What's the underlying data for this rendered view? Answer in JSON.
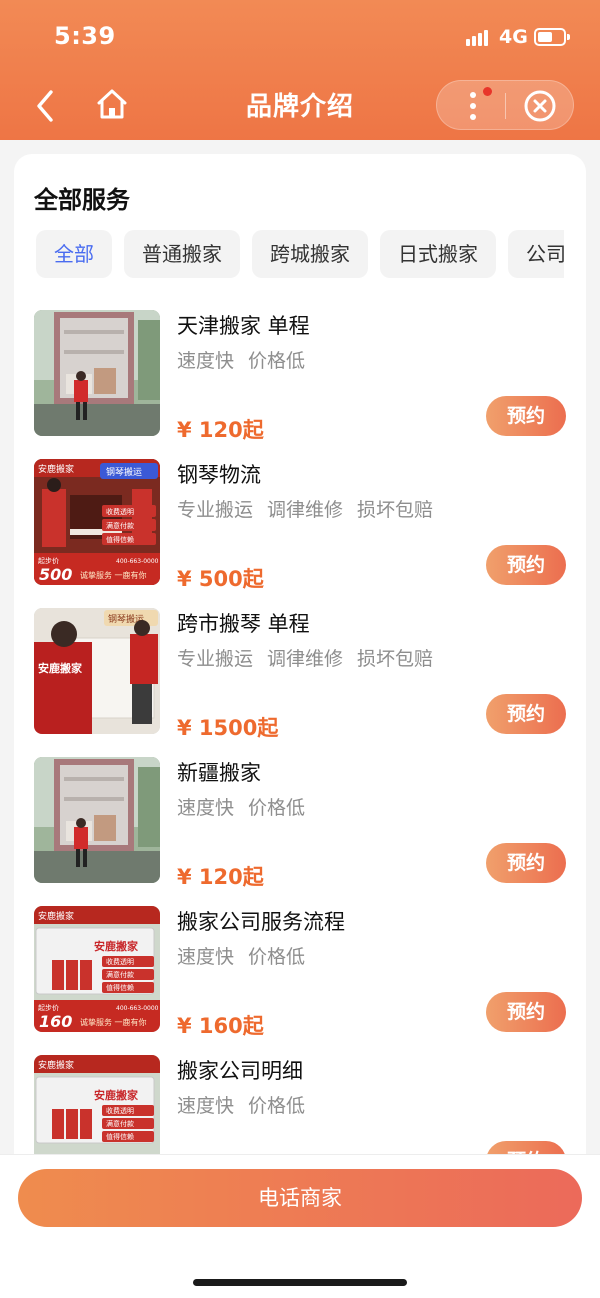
{
  "status_bar": {
    "time": "5:39",
    "network": "4G"
  },
  "nav": {
    "title": "品牌介绍"
  },
  "section": {
    "title": "全部服务"
  },
  "tabs": [
    {
      "label": "全部",
      "active": true
    },
    {
      "label": "普通搬家",
      "active": false
    },
    {
      "label": "跨城搬家",
      "active": false
    },
    {
      "label": "日式搬家",
      "active": false
    },
    {
      "label": "公司",
      "active": false
    }
  ],
  "items": [
    {
      "title": "天津搬家 单程",
      "tags": [
        "速度快",
        "价格低"
      ],
      "price": "¥ 120起",
      "button": "预约",
      "thumb": "truck-loading"
    },
    {
      "title": "钢琴物流",
      "tags": [
        "专业搬运",
        "调律维修",
        "损坏包赔"
      ],
      "price": "¥ 500起",
      "button": "预约",
      "thumb": "piano-promo",
      "thumb_text": {
        "brand": "安鹿搬家",
        "badge": "钢琴搬运",
        "bullets": [
          "收费透明",
          "满意付款",
          "值得信赖"
        ],
        "from_label": "起步价",
        "from_price": "500",
        "phone": "400-663-0000",
        "slogan": "诚挚服务 一鹿有你"
      }
    },
    {
      "title": "跨市搬琴 单程",
      "tags": [
        "专业搬运",
        "调律维修",
        "损坏包赔"
      ],
      "price": "¥ 1500起",
      "button": "预约",
      "thumb": "piano-movers",
      "thumb_text": {
        "badge": "钢琴搬运",
        "shirt": "安鹿搬家"
      }
    },
    {
      "title": "新疆搬家",
      "tags": [
        "速度快",
        "价格低"
      ],
      "price": "¥ 120起",
      "button": "预约",
      "thumb": "truck-loading"
    },
    {
      "title": "搬家公司服务流程",
      "tags": [
        "速度快",
        "价格低"
      ],
      "price": "¥ 160起",
      "button": "预约",
      "thumb": "truck-promo",
      "thumb_text": {
        "brand": "安鹿搬家",
        "truck": "安鹿搬家",
        "bullets": [
          "收费透明",
          "满意付款",
          "值得信赖"
        ],
        "from_label": "起步价",
        "from_price": "160",
        "phone": "400-663-0000",
        "slogan": "诚挚服务 一鹿有你"
      }
    },
    {
      "title": "搬家公司明细",
      "tags": [
        "速度快",
        "价格低"
      ],
      "price": "",
      "button": "预约",
      "thumb": "truck-promo",
      "thumb_text": {
        "brand": "安鹿搬家",
        "truck": "安鹿搬家",
        "bullets": [
          "收费透明",
          "满意付款",
          "值得信赖"
        ]
      }
    }
  ],
  "bottom": {
    "call_label": "电话商家"
  },
  "colors": {
    "accent": "#ee7545",
    "price": "#ee6a2e",
    "tab_active": "#4a6cf0"
  }
}
